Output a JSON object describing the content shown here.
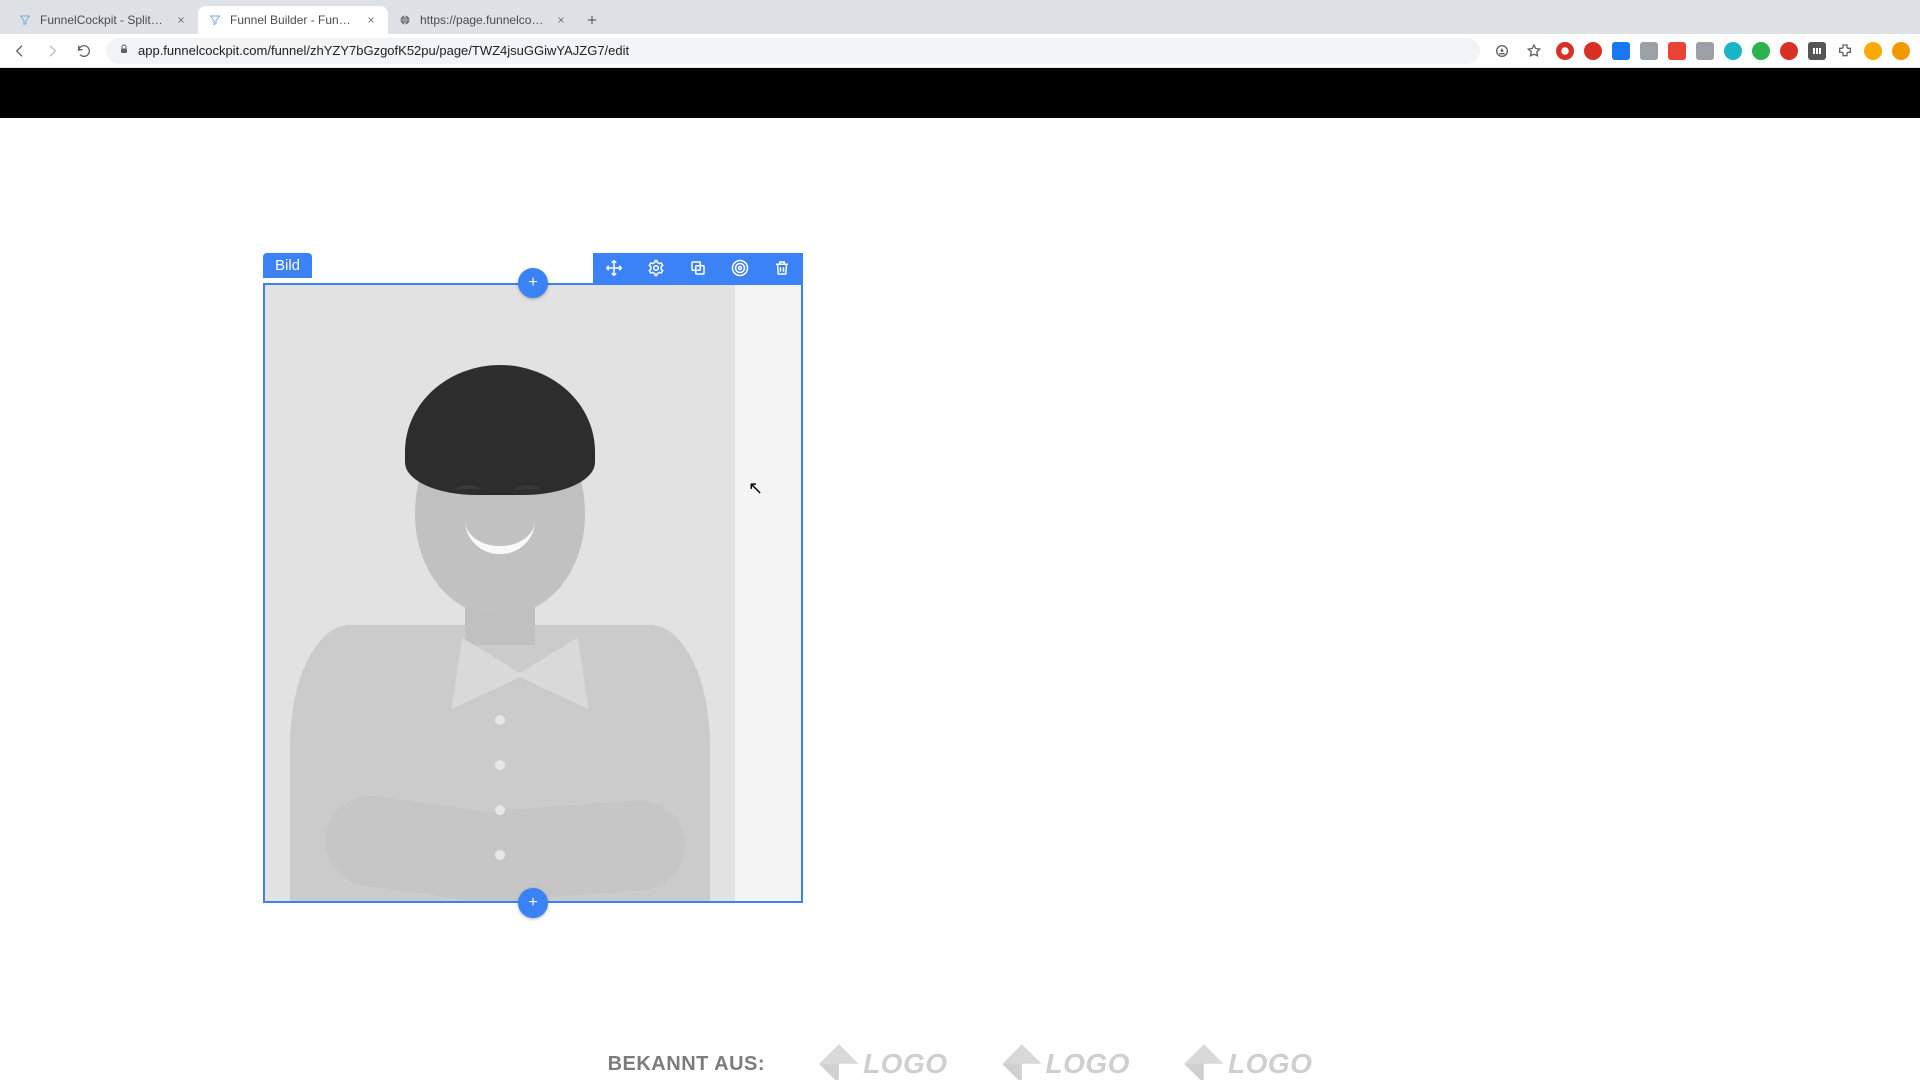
{
  "browser": {
    "tabs": [
      {
        "title": "FunnelCockpit - Splittests, Ma",
        "active": false
      },
      {
        "title": "Funnel Builder - FunnelCockpit",
        "active": true
      },
      {
        "title": "https://page.funnelcockpit.co",
        "active": false
      }
    ],
    "url": "app.funnelcockpit.com/funnel/zhYZY7bGzgofK52pu/page/TWZ4jsuGGiwYAJZG7/edit"
  },
  "editor": {
    "selected_element_label": "Bild",
    "toolbar": {
      "move": "Verschieben",
      "settings": "Einstellungen",
      "copy": "Kopieren",
      "style": "Stil",
      "delete": "Löschen"
    },
    "add_button_glyph": "+"
  },
  "footer": {
    "label": "BEKANNT AUS:",
    "logo_text": "LOGO"
  }
}
